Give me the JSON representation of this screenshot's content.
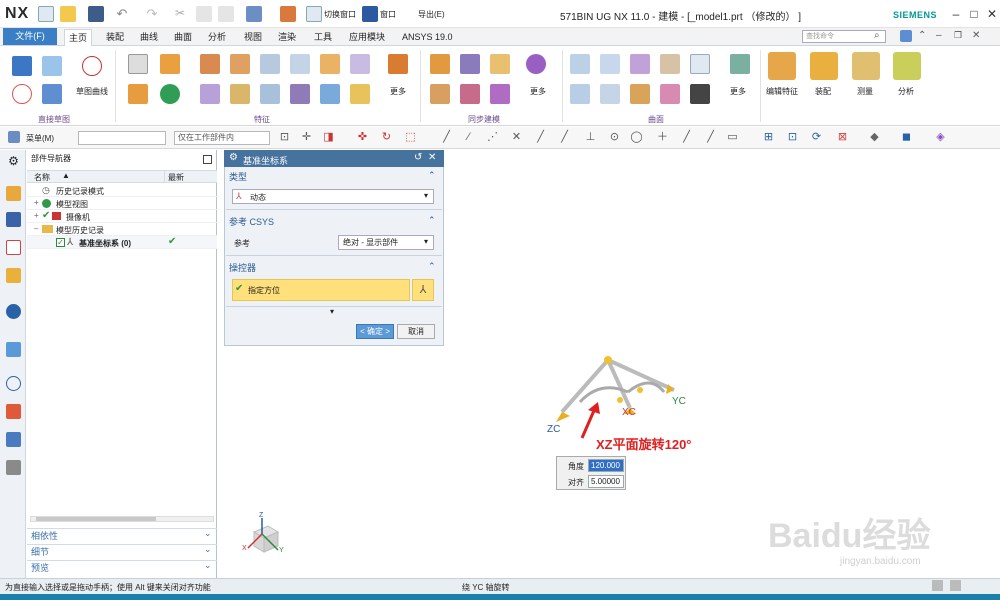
{
  "app": {
    "logo": "NX",
    "title": "571BIN UG NX 11.0 - 建模 - [_model1.prt （修改的） ]",
    "brand": "SIEMENS",
    "quick_access": {
      "switch_window": "切换窗口",
      "window": "窗口",
      "export": "导出(E)"
    }
  },
  "ribbon_tabs": {
    "file": "文件(F)",
    "tabs": [
      "主页",
      "装配",
      "曲线",
      "曲面",
      "分析",
      "视图",
      "渲染",
      "工具",
      "应用模块",
      "ANSYS 19.0"
    ],
    "search_placeholder": "查找命令"
  },
  "ribbon": {
    "sketch_curve": "草图曲线",
    "more": "更多",
    "edit_feature": "编辑特征",
    "assembly": "装配",
    "measure": "测量",
    "analysis": "分析",
    "groups": {
      "direct_sketch": "直接草图",
      "feature": "特征",
      "sync_modeling": "同步建模",
      "surface": "曲面"
    }
  },
  "toolbar2": {
    "menu": "菜单(M)",
    "filter_placeholder": "",
    "scope": "仅在工作部件内"
  },
  "navigator": {
    "title": "部件导航器",
    "col_name": "名称",
    "col_latest": "最新",
    "rows": [
      {
        "label": "历史记录模式"
      },
      {
        "label": "模型视图"
      },
      {
        "label": "摄像机"
      },
      {
        "label": "模型历史记录"
      },
      {
        "label": "基准坐标系 (0)"
      }
    ],
    "bottom": [
      "相依性",
      "细节",
      "预览"
    ]
  },
  "dialog": {
    "title": "基准坐标系",
    "type_section": "类型",
    "type_value": "动态",
    "ref_section": "参考 CSYS",
    "ref_label": "参考",
    "ref_value": "绝对 - 显示部件",
    "manip_section": "操控器",
    "specify_orientation": "指定方位",
    "ok": "< 确定 >",
    "cancel": "取消"
  },
  "viewport": {
    "axis_xc": "XC",
    "axis_yc": "YC",
    "axis_zc": "ZC",
    "annotation": "XZ平面旋转120°",
    "angle_label": "角度",
    "angle_value": "120.000",
    "snap_label": "对齐",
    "snap_value": "5.00000",
    "triad": {
      "x": "X",
      "y": "Y",
      "z": "Z"
    }
  },
  "watermark": {
    "brand": "Baidu经验",
    "url": "jingyan.baidu.com"
  },
  "status": {
    "left": "为直接输入选择或是拖动手柄；使用 Alt 键来关闭对齐功能",
    "center": "绕 YC 轴旋转"
  },
  "colors": {
    "accent": "#3a7fc6",
    "dialog_title": "#46729e",
    "highlight": "#ffe07a",
    "annotation": "#e02020"
  }
}
